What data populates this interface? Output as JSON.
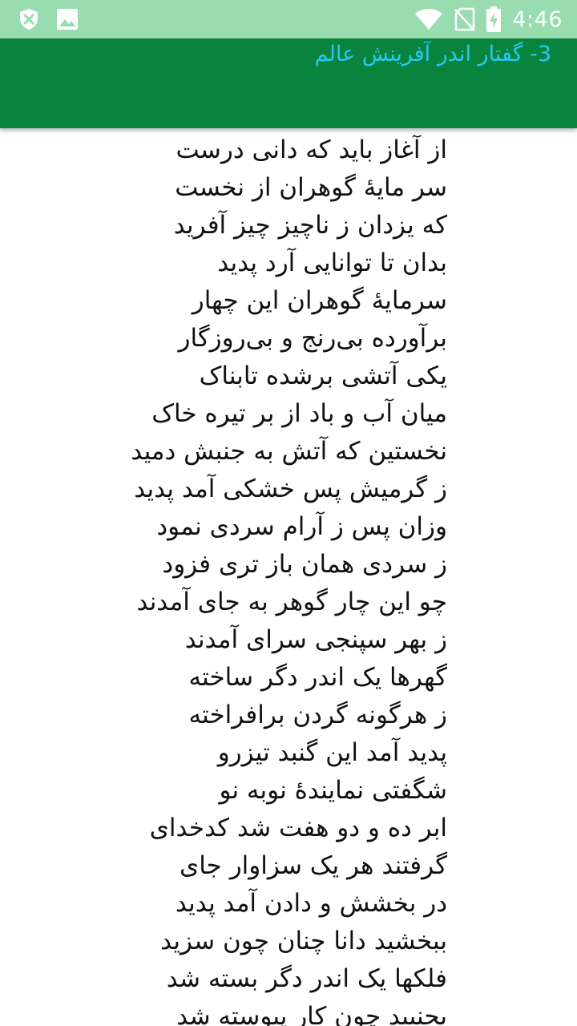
{
  "status_bar": {
    "time": "4:46",
    "icons": [
      "shield-icon",
      "image-icon",
      "wifi-icon",
      "no-sim-icon",
      "battery-charging-icon"
    ]
  },
  "app_bar": {
    "title": "3- گفتار اندر آفرینش عالم",
    "background_color": "#08843e",
    "title_color": "#29c8f3"
  },
  "poem": {
    "verses": [
      "از آغاز باید که دانی درست",
      "سر مایهٔ گوهران از نخست",
      "که یزدان ز ناچیز چیز آفرید",
      "بدان تا توانایی آرد پدید",
      "سرمایهٔ گوهران این چهار",
      "برآورده بی‌رنج و بی‌روزگار",
      "یکی آتشی برشده تابناک",
      "میان آب و باد از بر تیره خاک",
      "نخستین که آتش به جنبش دمید",
      "ز گرمیش پس خشکی آمد پدید",
      "وزان پس ز آرام سردی نمود",
      "ز سردی همان باز تری فزود",
      "چو این چار گوهر به جای آمدند",
      "ز بهر سپنجی سرای آمدند",
      "گهرها یک اندر دگر ساخته",
      "ز هرگونه گردن برافراخته",
      "پدید آمد این گنبد تیزرو",
      "شگفتی نمایندهٔ نوبه نو",
      "ابر ده و دو هفت شد کدخدای",
      "گرفتند هر یک سزاوار جای",
      "در بخشش و دادن آمد پدید",
      "ببخشید دانا چنان چون سزید",
      "فلکها یک اندر دگر بسته شد",
      "بجنبید چون کار پیوسته شد"
    ]
  }
}
